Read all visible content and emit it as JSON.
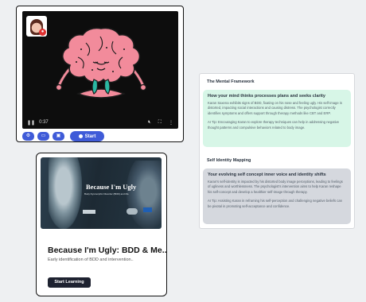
{
  "video": {
    "time": "0:37",
    "toolbar": {
      "start_label": "Start"
    }
  },
  "course": {
    "cover_title": "Because I'm Ugly",
    "cover_subtitle": "Body Dysmorphic Disorder (BDD) and Me",
    "title": "Because I'm Ugly: BDD & Me..",
    "description": "Early identification of BDD and intervention..",
    "button_label": "Start Learning"
  },
  "notes": {
    "section1": {
      "heading": "The Mental Framework",
      "title": "How your mind thinks processes plans and seeks clarity",
      "body": "Karan Saxena exhibits signs of BDD, fixating on his nose and feeling ugly. His self-image is distorted, impacting social interactions and causing distress. The psychologist correctly identifies symptoms and offers support through therapy methods like CBT and ERP.",
      "tip": "AI Tip: Encouraging Karan to explore therapy techniques can help in addressing negative thought patterns and compulsive behaviors related to body image."
    },
    "section2": {
      "heading": "Self Identity Mapping",
      "title": "Your evolving self concept inner voice and identity shifts",
      "body": "Karan's self-identity is impacted by his distorted body image perceptions, leading to feelings of ugliness and worthlessness. The psychologist's intervention aims to help Karan reshape his self-concept and develop a healthier self-image through therapy.",
      "tip": "AI Tip: Assisting Karan in reframing his self-perception and challenging negative beliefs can be pivotal in promoting self-acceptance and confidence."
    }
  },
  "colors": {
    "accent": "#3f5bd8",
    "note_green": "#d7f6e7",
    "note_gray": "#d5d8de",
    "brain": "#f28b9b"
  }
}
